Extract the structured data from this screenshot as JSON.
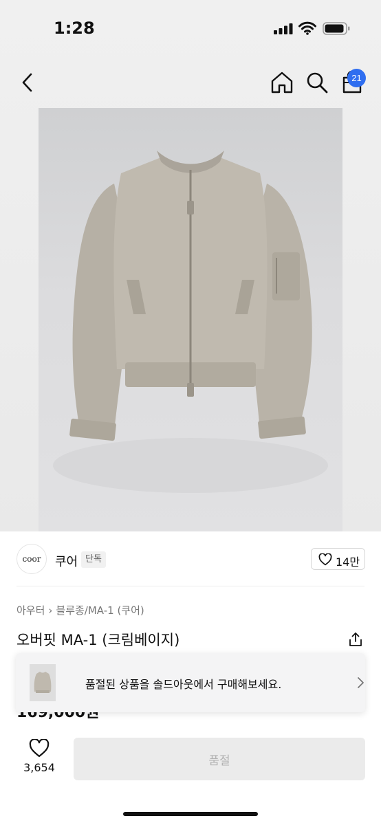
{
  "status_bar": {
    "time": "1:28"
  },
  "nav": {
    "cart_count": "21"
  },
  "brand": {
    "logo_text": "coor",
    "name": "쿠어",
    "badge": "단독",
    "likes": "14만"
  },
  "breadcrumb": [
    "아우터",
    "블루종/MA-1 (쿠어)"
  ],
  "product": {
    "title": "오버핏 MA-1 (크림베이지)",
    "price": "169,000원"
  },
  "soldout_notice": {
    "text": "품절된 상품을 솔드아웃에서 구매해보세요."
  },
  "bottom_bar": {
    "like_count": "3,654",
    "button_label": "품절"
  },
  "colors": {
    "accent": "#2f6ef0",
    "jacket": "#bcb6ab"
  }
}
